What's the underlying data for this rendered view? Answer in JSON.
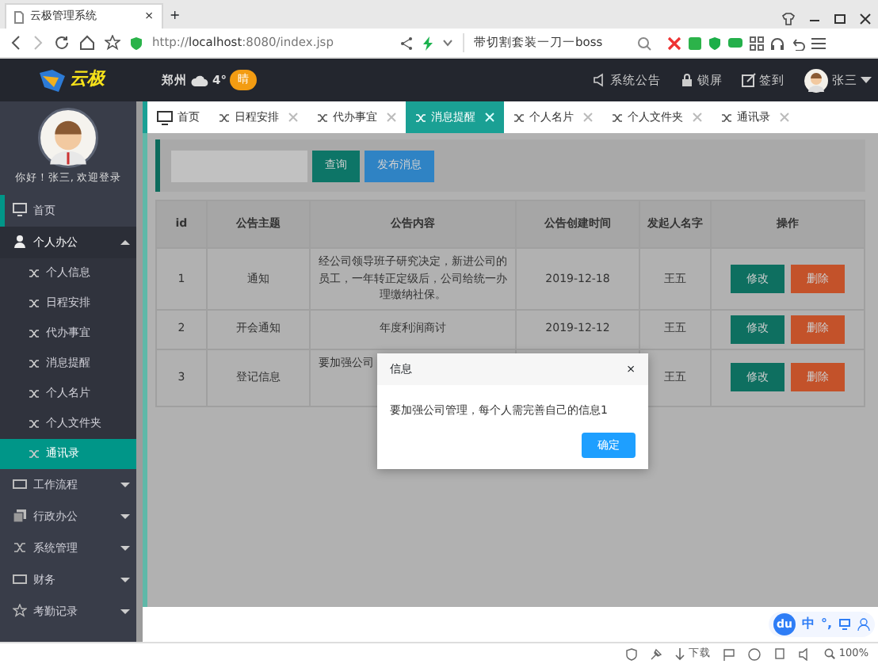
{
  "browser": {
    "tab_title": "云极管理系统",
    "tab_close": "×",
    "new_tab": "+",
    "url_prefix": "http://",
    "url_host": "localhost",
    "url_rest": ":8080/index.jsp",
    "search_text": "带切割套装一刀一boss"
  },
  "header": {
    "logo": "云极",
    "city": "郑州",
    "temperature": "4°",
    "weather": "晴",
    "links": [
      {
        "kind": "speaker",
        "label": "系统公告"
      },
      {
        "kind": "lock",
        "label": "锁屏"
      },
      {
        "kind": "edit",
        "label": "签到"
      }
    ],
    "user": "张三"
  },
  "sidebar": {
    "greeting": "你好！张三, 欢迎登录",
    "items": [
      {
        "kind": "monitor",
        "label": "首页",
        "selected": false,
        "marked": true
      },
      {
        "kind": "person",
        "label": "个人办公",
        "expanded": true,
        "children": [
          {
            "label": "个人信息",
            "selected": false
          },
          {
            "label": "日程安排",
            "selected": false
          },
          {
            "label": "代办事宜",
            "selected": false
          },
          {
            "label": "消息提醒",
            "selected": false
          },
          {
            "label": "个人名片",
            "selected": false
          },
          {
            "label": "个人文件夹",
            "selected": false
          },
          {
            "label": "通讯录",
            "selected": true
          }
        ]
      },
      {
        "kind": "card",
        "label": "工作流程",
        "expanded": false
      },
      {
        "kind": "copy",
        "label": "行政办公",
        "expanded": false
      },
      {
        "kind": "shuffle",
        "label": "系统管理",
        "expanded": false
      },
      {
        "kind": "card",
        "label": "财务",
        "expanded": false
      },
      {
        "kind": "star",
        "label": "考勤记录",
        "expanded": false
      }
    ]
  },
  "tabs": [
    {
      "label": "首页",
      "kind": "home",
      "selected": false
    },
    {
      "label": "日程安排",
      "kind": "page",
      "selected": false
    },
    {
      "label": "代办事宜",
      "kind": "page",
      "selected": false
    },
    {
      "label": "消息提醒",
      "kind": "page",
      "selected": true
    },
    {
      "label": "个人名片",
      "kind": "page",
      "selected": false
    },
    {
      "label": "个人文件夹",
      "kind": "page",
      "selected": false
    },
    {
      "label": "通讯录",
      "kind": "page",
      "selected": false
    }
  ],
  "toolbar": {
    "search_button": "查询",
    "publish_button": "发布消息"
  },
  "table": {
    "columns": [
      "id",
      "公告主题",
      "公告内容",
      "公告创建时间",
      "发起人名字",
      "操作"
    ],
    "rows": [
      {
        "id": "1",
        "subject": "通知",
        "content": "经公司领导班子研究决定，新进公司的员工，一年转正定级后，公司给统一办理缴纳社保。",
        "date": "2019-12-18",
        "author": "王五",
        "edit_label": "修改",
        "delete_label": "删除"
      },
      {
        "id": "2",
        "subject": "开会通知",
        "content": "年度利润商讨",
        "date": "2019-12-12",
        "author": "王五",
        "edit_label": "修改",
        "delete_label": "删除"
      },
      {
        "id": "3",
        "subject": "登记信息",
        "content": "要加强公司",
        "date": "",
        "author": "王五",
        "edit_label": "修改",
        "delete_label": "删除"
      }
    ]
  },
  "dialog": {
    "title": "信息",
    "close": "×",
    "message": "要加强公司管理，每个人需完善自己的信息1",
    "ok": "确定"
  },
  "ime": {
    "logo": "du",
    "mode": "中",
    "punct": "°,"
  },
  "status_bar": {
    "download": "下载",
    "zoom": "100%"
  }
}
